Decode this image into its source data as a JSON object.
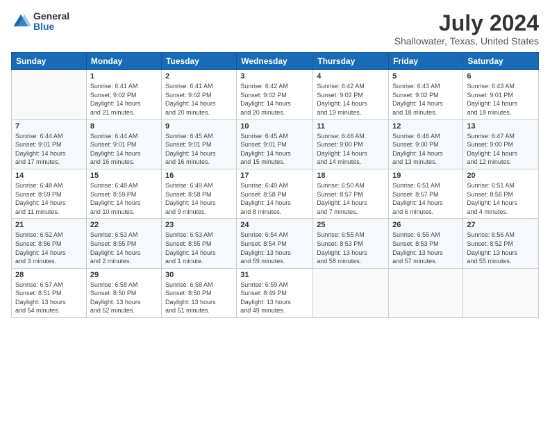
{
  "header": {
    "logo_line1": "General",
    "logo_line2": "Blue",
    "month_year": "July 2024",
    "location": "Shallowater, Texas, United States"
  },
  "weekdays": [
    "Sunday",
    "Monday",
    "Tuesday",
    "Wednesday",
    "Thursday",
    "Friday",
    "Saturday"
  ],
  "weeks": [
    [
      {
        "day": "",
        "info": ""
      },
      {
        "day": "1",
        "info": "Sunrise: 6:41 AM\nSunset: 9:02 PM\nDaylight: 14 hours\nand 21 minutes."
      },
      {
        "day": "2",
        "info": "Sunrise: 6:41 AM\nSunset: 9:02 PM\nDaylight: 14 hours\nand 20 minutes."
      },
      {
        "day": "3",
        "info": "Sunrise: 6:42 AM\nSunset: 9:02 PM\nDaylight: 14 hours\nand 20 minutes."
      },
      {
        "day": "4",
        "info": "Sunrise: 6:42 AM\nSunset: 9:02 PM\nDaylight: 14 hours\nand 19 minutes."
      },
      {
        "day": "5",
        "info": "Sunrise: 6:43 AM\nSunset: 9:02 PM\nDaylight: 14 hours\nand 18 minutes."
      },
      {
        "day": "6",
        "info": "Sunrise: 6:43 AM\nSunset: 9:01 PM\nDaylight: 14 hours\nand 18 minutes."
      }
    ],
    [
      {
        "day": "7",
        "info": "Sunrise: 6:44 AM\nSunset: 9:01 PM\nDaylight: 14 hours\nand 17 minutes."
      },
      {
        "day": "8",
        "info": "Sunrise: 6:44 AM\nSunset: 9:01 PM\nDaylight: 14 hours\nand 16 minutes."
      },
      {
        "day": "9",
        "info": "Sunrise: 6:45 AM\nSunset: 9:01 PM\nDaylight: 14 hours\nand 16 minutes."
      },
      {
        "day": "10",
        "info": "Sunrise: 6:45 AM\nSunset: 9:01 PM\nDaylight: 14 hours\nand 15 minutes."
      },
      {
        "day": "11",
        "info": "Sunrise: 6:46 AM\nSunset: 9:00 PM\nDaylight: 14 hours\nand 14 minutes."
      },
      {
        "day": "12",
        "info": "Sunrise: 6:46 AM\nSunset: 9:00 PM\nDaylight: 14 hours\nand 13 minutes."
      },
      {
        "day": "13",
        "info": "Sunrise: 6:47 AM\nSunset: 9:00 PM\nDaylight: 14 hours\nand 12 minutes."
      }
    ],
    [
      {
        "day": "14",
        "info": "Sunrise: 6:48 AM\nSunset: 8:59 PM\nDaylight: 14 hours\nand 11 minutes."
      },
      {
        "day": "15",
        "info": "Sunrise: 6:48 AM\nSunset: 8:59 PM\nDaylight: 14 hours\nand 10 minutes."
      },
      {
        "day": "16",
        "info": "Sunrise: 6:49 AM\nSunset: 8:58 PM\nDaylight: 14 hours\nand 9 minutes."
      },
      {
        "day": "17",
        "info": "Sunrise: 6:49 AM\nSunset: 8:58 PM\nDaylight: 14 hours\nand 8 minutes."
      },
      {
        "day": "18",
        "info": "Sunrise: 6:50 AM\nSunset: 8:57 PM\nDaylight: 14 hours\nand 7 minutes."
      },
      {
        "day": "19",
        "info": "Sunrise: 6:51 AM\nSunset: 8:57 PM\nDaylight: 14 hours\nand 6 minutes."
      },
      {
        "day": "20",
        "info": "Sunrise: 6:51 AM\nSunset: 8:56 PM\nDaylight: 14 hours\nand 4 minutes."
      }
    ],
    [
      {
        "day": "21",
        "info": "Sunrise: 6:52 AM\nSunset: 8:56 PM\nDaylight: 14 hours\nand 3 minutes."
      },
      {
        "day": "22",
        "info": "Sunrise: 6:53 AM\nSunset: 8:55 PM\nDaylight: 14 hours\nand 2 minutes."
      },
      {
        "day": "23",
        "info": "Sunrise: 6:53 AM\nSunset: 8:55 PM\nDaylight: 14 hours\nand 1 minute."
      },
      {
        "day": "24",
        "info": "Sunrise: 6:54 AM\nSunset: 8:54 PM\nDaylight: 13 hours\nand 59 minutes."
      },
      {
        "day": "25",
        "info": "Sunrise: 6:55 AM\nSunset: 8:53 PM\nDaylight: 13 hours\nand 58 minutes."
      },
      {
        "day": "26",
        "info": "Sunrise: 6:55 AM\nSunset: 8:53 PM\nDaylight: 13 hours\nand 57 minutes."
      },
      {
        "day": "27",
        "info": "Sunrise: 6:56 AM\nSunset: 8:52 PM\nDaylight: 13 hours\nand 55 minutes."
      }
    ],
    [
      {
        "day": "28",
        "info": "Sunrise: 6:57 AM\nSunset: 8:51 PM\nDaylight: 13 hours\nand 54 minutes."
      },
      {
        "day": "29",
        "info": "Sunrise: 6:58 AM\nSunset: 8:50 PM\nDaylight: 13 hours\nand 52 minutes."
      },
      {
        "day": "30",
        "info": "Sunrise: 6:58 AM\nSunset: 8:50 PM\nDaylight: 13 hours\nand 51 minutes."
      },
      {
        "day": "31",
        "info": "Sunrise: 6:59 AM\nSunset: 8:49 PM\nDaylight: 13 hours\nand 49 minutes."
      },
      {
        "day": "",
        "info": ""
      },
      {
        "day": "",
        "info": ""
      },
      {
        "day": "",
        "info": ""
      }
    ]
  ]
}
